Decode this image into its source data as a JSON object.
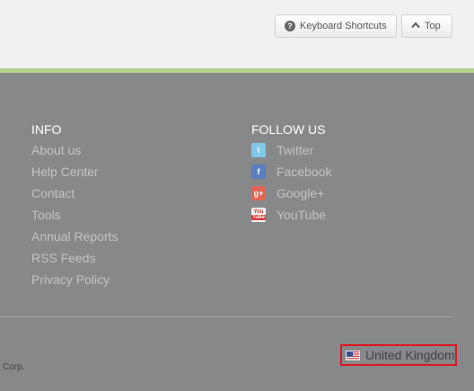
{
  "toolbar": {
    "shortcuts_label": "Keyboard Shortcuts",
    "shortcuts_icon": "question-icon",
    "top_label": "Top",
    "top_icon": "chevron-up-icon"
  },
  "footer": {
    "info": {
      "title": "INFO",
      "links": [
        "About us",
        "Help Center",
        "Contact",
        "Tools",
        "Annual Reports",
        "RSS Feeds",
        "Privacy Policy"
      ]
    },
    "follow": {
      "title": "FOLLOW US",
      "items": [
        {
          "label": "Twitter",
          "icon": "twitter-icon"
        },
        {
          "label": "Facebook",
          "icon": "facebook-icon"
        },
        {
          "label": "Google+",
          "icon": "google-plus-icon"
        },
        {
          "label": "YouTube",
          "icon": "youtube-icon"
        }
      ]
    },
    "country_selector": {
      "label": "United Kingdom",
      "icon": "us-flag-icon"
    },
    "corp_text": "Corp."
  },
  "colors": {
    "footer_bg": "#86888a",
    "topbar_bg": "#f1f1f1",
    "accent_line": "#b4d38c",
    "highlight_border": "#e0141e",
    "link_text": "#c2c4c5"
  }
}
